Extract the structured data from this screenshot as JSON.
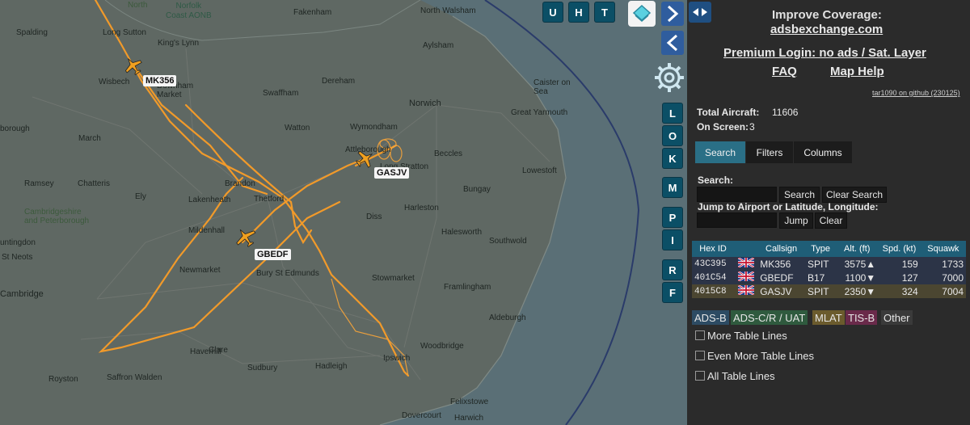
{
  "map": {
    "towns": [
      {
        "name": "North",
        "cls": "region"
      },
      {
        "name": "Norfolk\nCoast AONB",
        "cls": "aonb"
      },
      {
        "name": "Fakenham",
        "cls": ""
      },
      {
        "name": "North Walsham",
        "cls": ""
      },
      {
        "name": "Spalding",
        "cls": ""
      },
      {
        "name": "King's Lynn",
        "cls": ""
      },
      {
        "name": "Long Sutton",
        "cls": ""
      },
      {
        "name": "Wisbech",
        "cls": ""
      },
      {
        "name": "Aylsham",
        "cls": ""
      },
      {
        "name": "Swaffham",
        "cls": ""
      },
      {
        "name": "Dereham",
        "cls": ""
      },
      {
        "name": "Norwich",
        "cls": "big"
      },
      {
        "name": "Caister on\nSea",
        "cls": ""
      },
      {
        "name": "Great Yarmouth",
        "cls": ""
      },
      {
        "name": "Downham\nMarket",
        "cls": ""
      },
      {
        "name": "Watton",
        "cls": ""
      },
      {
        "name": "Wymondham",
        "cls": ""
      },
      {
        "name": "borough",
        "cls": ""
      },
      {
        "name": "March",
        "cls": ""
      },
      {
        "name": "Attleborough",
        "cls": ""
      },
      {
        "name": "Long Stratton",
        "cls": ""
      },
      {
        "name": "Beccles",
        "cls": ""
      },
      {
        "name": "Lowestoft",
        "cls": ""
      },
      {
        "name": "Ramsey",
        "cls": ""
      },
      {
        "name": "Chatteris",
        "cls": ""
      },
      {
        "name": "Brandon",
        "cls": ""
      },
      {
        "name": "Thetford",
        "cls": ""
      },
      {
        "name": "Bungay",
        "cls": ""
      },
      {
        "name": "Ely",
        "cls": ""
      },
      {
        "name": "Lakenheath",
        "cls": ""
      },
      {
        "name": "Harleston",
        "cls": ""
      },
      {
        "name": "Cambridgeshire\nand Peterborough",
        "cls": "region"
      },
      {
        "name": "Diss",
        "cls": ""
      },
      {
        "name": "Mildenhall",
        "cls": ""
      },
      {
        "name": "Halesworth",
        "cls": ""
      },
      {
        "name": "untingdon",
        "cls": ""
      },
      {
        "name": "Southwold",
        "cls": ""
      },
      {
        "name": "St Neots",
        "cls": ""
      },
      {
        "name": "Newmarket",
        "cls": ""
      },
      {
        "name": "Bury St Edmunds",
        "cls": ""
      },
      {
        "name": "Stowmarket",
        "cls": ""
      },
      {
        "name": "Cambridge",
        "cls": "big"
      },
      {
        "name": "Framlingham",
        "cls": ""
      },
      {
        "name": "Haverhill",
        "cls": ""
      },
      {
        "name": "Clare",
        "cls": ""
      },
      {
        "name": "Aldeburgh",
        "cls": ""
      },
      {
        "name": "Sudbury",
        "cls": ""
      },
      {
        "name": "Hadleigh",
        "cls": ""
      },
      {
        "name": "Woodbridge",
        "cls": ""
      },
      {
        "name": "Royston",
        "cls": ""
      },
      {
        "name": "Saffron Walden",
        "cls": ""
      },
      {
        "name": "Ipswich",
        "cls": ""
      },
      {
        "name": "Felixstowe",
        "cls": ""
      },
      {
        "name": "Dovercourt",
        "cls": ""
      },
      {
        "name": "Harwich",
        "cls": ""
      }
    ],
    "aircraft_labels": [
      "MK356",
      "GBEDF",
      "GASJV"
    ],
    "buttons": {
      "u": "U",
      "h": "H",
      "t": "T",
      "side": [
        "L",
        "O",
        "K",
        "M",
        "P",
        "I",
        "R",
        "F"
      ]
    }
  },
  "panel": {
    "improve_line1": "Improve Coverage:",
    "improve_line2": "adsbexchange.com",
    "premium": "Premium Login: no ads / Sat. Layer",
    "faq": "FAQ",
    "map_help": "Map Help",
    "version": "tar1090 on github (230125)",
    "total_label": "Total Aircraft:",
    "total_value": "11606",
    "onscreen_label": "On Screen:",
    "onscreen_value": "3",
    "tabs": [
      "Search",
      "Filters",
      "Columns"
    ],
    "search_label": "Search:",
    "search_btn": "Search",
    "clear_search_btn": "Clear Search",
    "jump_label": "Jump to Airport or Latitude, Longitude:",
    "jump_btn": "Jump",
    "clear_btn": "Clear",
    "table": {
      "headers": [
        "Hex ID",
        "",
        "Callsign",
        "Type",
        "Alt. (ft)",
        "Spd. (kt)",
        "Squawk"
      ],
      "rows": [
        {
          "hex": "43C395",
          "callsign": "MK356",
          "type": "SPIT",
          "alt": "3575▲",
          "spd": "159",
          "squawk": "1733",
          "bg": "#2c3447"
        },
        {
          "hex": "401C54",
          "callsign": "GBEDF",
          "type": "B17",
          "alt": "1100▼",
          "spd": "127",
          "squawk": "7000",
          "bg": "#2c3447"
        },
        {
          "hex": "4015C8",
          "callsign": "GASJV",
          "type": "SPIT",
          "alt": "2350▼",
          "spd": "324",
          "squawk": "7004",
          "bg": "#4b4631"
        }
      ]
    },
    "legend": [
      {
        "label": "ADS-B",
        "color": "#2d4b63"
      },
      {
        "label": "ADS-C/R / UAT",
        "color": "#2f5a3e"
      },
      {
        "label": "MLAT",
        "color": "#6b5b2d"
      },
      {
        "label": "TIS-B",
        "color": "#6a2a4a"
      },
      {
        "label": "Other",
        "color": "#3a3a3a"
      }
    ],
    "checkboxes": [
      "More Table Lines",
      "Even More Table Lines",
      "All Table Lines"
    ]
  }
}
